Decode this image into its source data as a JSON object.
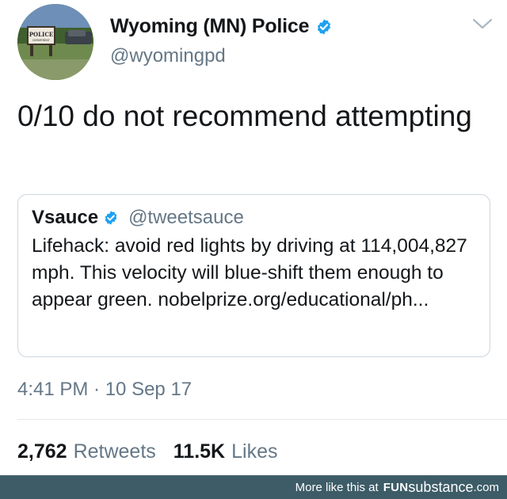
{
  "author": {
    "display_name": "Wyoming (MN) Police",
    "handle": "@wyomingpd",
    "avatar_sign_text": "POLICE",
    "avatar_sign_subtext": "DEPARTMENT",
    "verified": true
  },
  "tweet": {
    "text": "0/10 do not recommend attempting",
    "timestamp": "4:41 PM · 10 Sep 17"
  },
  "quoted_tweet": {
    "display_name": "Vsauce",
    "handle": "@tweetsauce",
    "verified": true,
    "text": "Lifehack: avoid red lights by driving at 114,004,827 mph. This velocity will blue-shift them enough to appear green. nobelprize.org/educational/ph..."
  },
  "stats": {
    "retweets_count": "2,762",
    "retweets_label": "Retweets",
    "likes_count": "11.5K",
    "likes_label": "Likes"
  },
  "banner": {
    "prefix": "More like this at",
    "brand_part1": "FUN",
    "brand_part2": "substance",
    "brand_part3": ".com"
  },
  "colors": {
    "verified_blue": "#1da1f2",
    "secondary_text": "#657786",
    "banner_bg": "#3d5c67"
  },
  "icons": {
    "verified": "verified-badge-icon",
    "caret": "chevron-down-icon"
  }
}
